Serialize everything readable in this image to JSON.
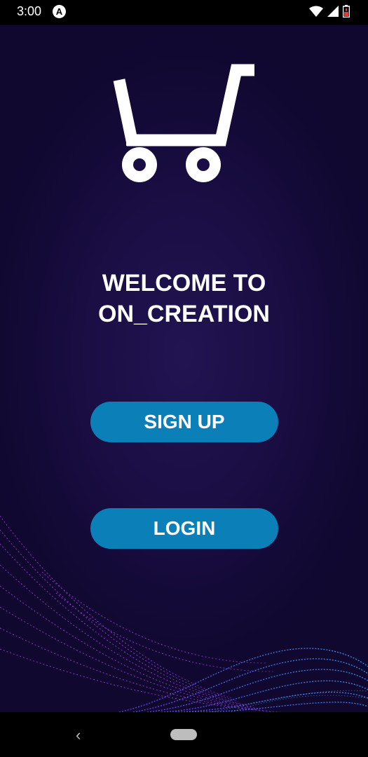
{
  "status": {
    "time": "3:00",
    "a_icon": "A"
  },
  "welcome": {
    "line1": "WELCOME TO",
    "line2": "ON_CREATION"
  },
  "buttons": {
    "signup": "SIGN UP",
    "login": "LOGIN"
  },
  "icons": {
    "logo": "shopping-cart-icon",
    "back": "back-icon",
    "home": "home-pill"
  },
  "colors": {
    "background": "#1b0e45",
    "button": "#0a7fb8",
    "text": "#ffffff",
    "wave_purple": "#c23cff",
    "wave_blue": "#3aa0ff"
  },
  "nav": {
    "back_glyph": "‹"
  }
}
